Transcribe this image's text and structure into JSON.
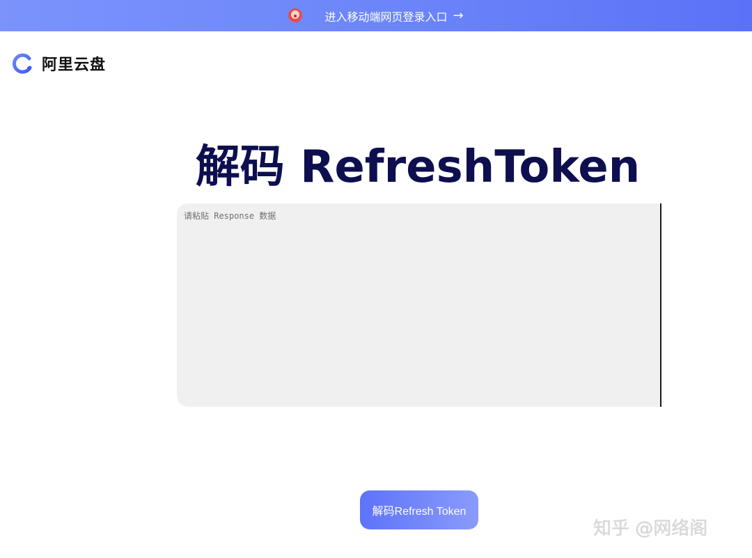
{
  "banner": {
    "text": "进入移动端网页登录入口",
    "arrow": "→",
    "emoji_icon": "clown-face-icon"
  },
  "logo": {
    "text": "阿里云盘",
    "icon": "aliyun-drive-logo-icon",
    "color": "#4f6ef7"
  },
  "main": {
    "title": "解码 RefreshToken",
    "input_placeholder": "请粘贴 Response 数据",
    "input_value": "",
    "button_label": "解码Refresh Token"
  },
  "watermark": {
    "text": "知乎 @网络阁"
  },
  "colors": {
    "banner_start": "#7b93fb",
    "banner_end": "#5a72f7",
    "title": "#0d0f4f",
    "button_start": "#5d73fa",
    "button_end": "#8a9bfb",
    "textarea_bg": "#f0f0f0"
  }
}
